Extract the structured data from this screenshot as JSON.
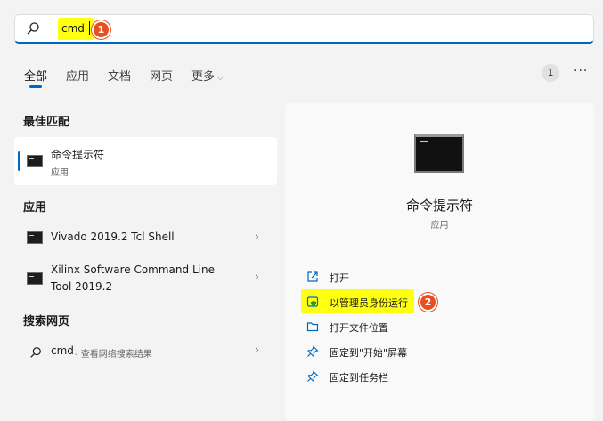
{
  "search": {
    "query": "cmd"
  },
  "annotations": {
    "step1": "1",
    "step2": "2"
  },
  "tabs": [
    {
      "label": "全部"
    },
    {
      "label": "应用"
    },
    {
      "label": "文档"
    },
    {
      "label": "网页"
    },
    {
      "label": "更多"
    }
  ],
  "toolbar": {
    "count": "1",
    "more": "···"
  },
  "sections": {
    "best_match": "最佳匹配",
    "apps": "应用",
    "web": "搜索网页"
  },
  "best_match": {
    "title": "命令提示符",
    "subtitle": "应用"
  },
  "apps": [
    {
      "title": "Vivado 2019.2 Tcl Shell"
    },
    {
      "title_line1": "Xilinx Software Command Line",
      "title_line2": "Tool 2019.2"
    }
  ],
  "web": {
    "query": "cmd",
    "suffix": " - 查看网络搜索结果"
  },
  "detail": {
    "name": "命令提示符",
    "type": "应用",
    "actions": [
      {
        "label": "打开",
        "icon": "open-external-icon"
      },
      {
        "label": "以管理员身份运行",
        "icon": "shield-admin-icon"
      },
      {
        "label": "打开文件位置",
        "icon": "folder-icon"
      },
      {
        "label": "固定到\"开始\"屏幕",
        "icon": "pin-icon"
      },
      {
        "label": "固定到任务栏",
        "icon": "pin-icon"
      }
    ]
  },
  "colors": {
    "accent": "#0067c0",
    "highlight": "#ffff10",
    "badge": "#e8501f"
  }
}
